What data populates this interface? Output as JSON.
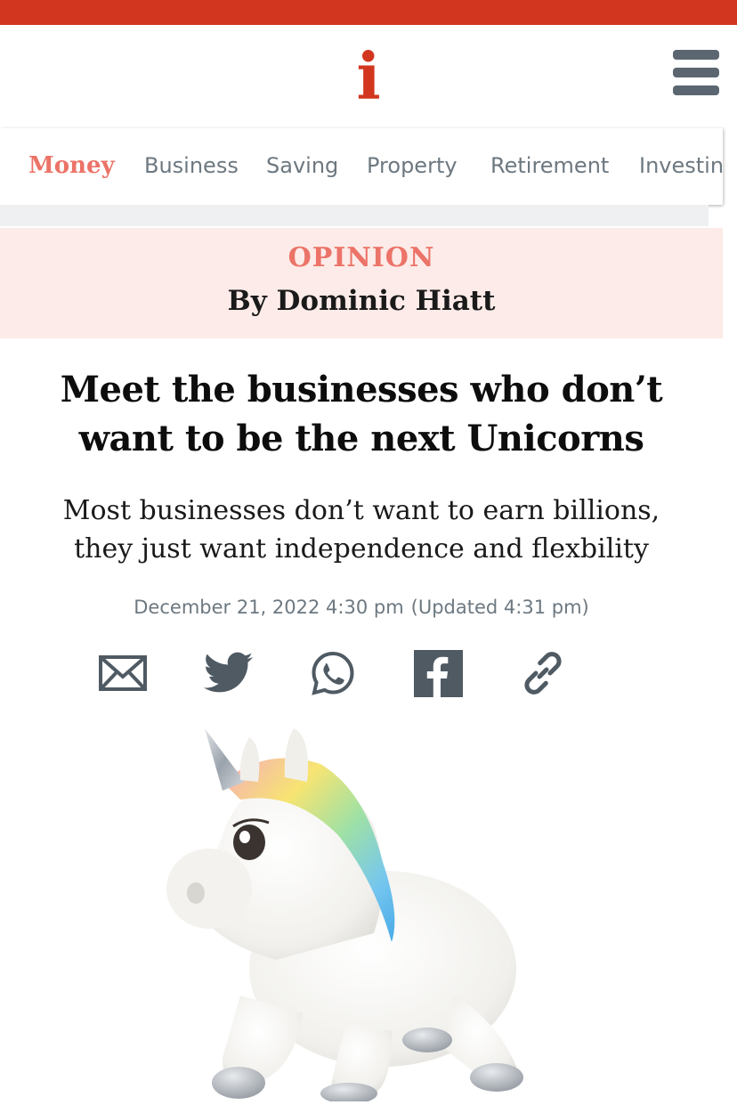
{
  "header": {
    "logo": "i",
    "menu_icon": "hamburger-menu-icon"
  },
  "nav": {
    "items": [
      {
        "label": "Money",
        "active": true
      },
      {
        "label": "Business"
      },
      {
        "label": "Saving"
      },
      {
        "label": "Property"
      },
      {
        "label": "Retirement"
      },
      {
        "label": "Investin"
      }
    ]
  },
  "article": {
    "category": "OPINION",
    "byline": "By Dominic Hiatt",
    "headline_line1": "Meet the businesses who don’t",
    "headline_line2": "want to be the next Unicorns",
    "standfirst_line1": "Most businesses don’t want to earn billions,",
    "standfirst_line2": "they just want independence and flexbility",
    "date": "December 21, 2022 4:30 pm",
    "updated": "(Updated 4:31 pm)"
  },
  "share": {
    "icons": [
      "email-icon",
      "twitter-icon",
      "whatsapp-icon",
      "facebook-icon",
      "link-icon"
    ]
  },
  "colors": {
    "brand_red": "#d2361e",
    "accent_pink": "#ec7368",
    "band_bg": "#fcebe8",
    "nav_grey": "#6d7880"
  }
}
